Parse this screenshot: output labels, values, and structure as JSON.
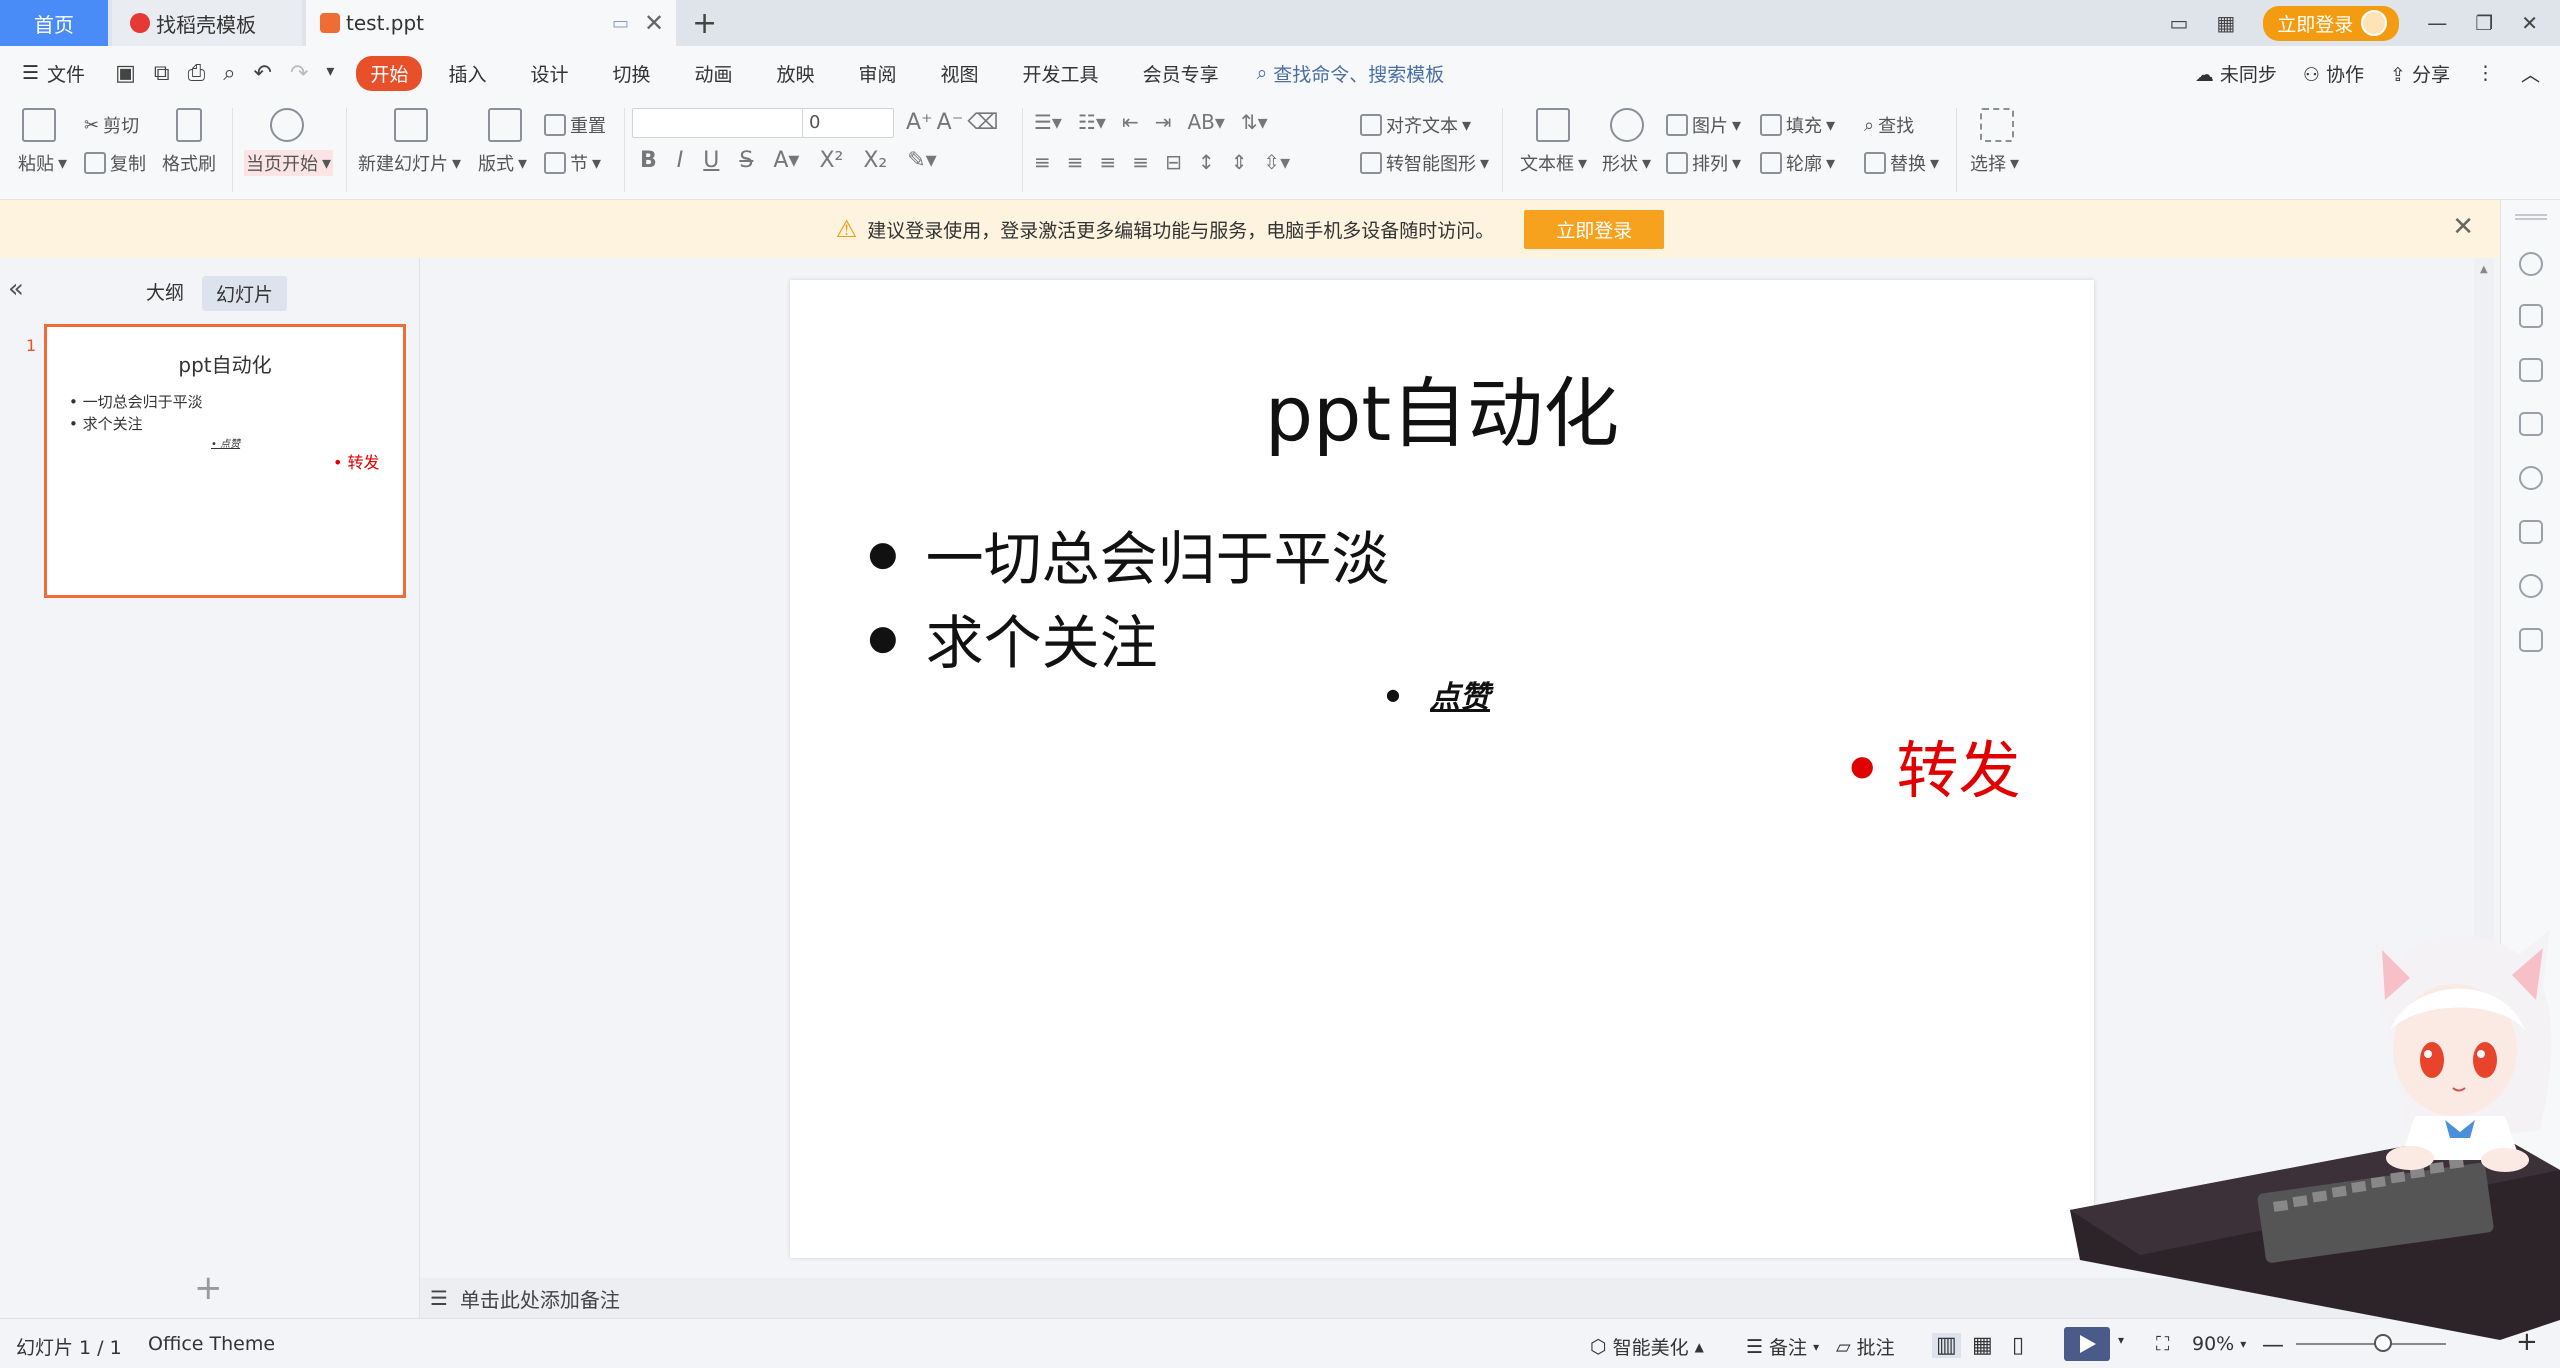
{
  "tabs": {
    "home": "首页",
    "template": "找稻壳模板",
    "document": "test.ppt"
  },
  "header": {
    "login_button": "立即登录"
  },
  "menu": {
    "file": "文件",
    "start": "开始",
    "items": [
      "插入",
      "设计",
      "切换",
      "动画",
      "放映",
      "审阅",
      "视图",
      "开发工具",
      "会员专享"
    ],
    "search": "查找命令、搜索模板",
    "sync": "未同步",
    "collab": "协作",
    "share": "分享"
  },
  "ribbon": {
    "paste": "粘贴",
    "cut": "剪切",
    "copy": "复制",
    "format_painter": "格式刷",
    "from_current": "当页开始",
    "new_slide": "新建幻灯片",
    "layout": "版式",
    "section": "节",
    "reset": "重置",
    "font_size": "0",
    "align_text": "对齐文本",
    "smart_shape": "转智能图形",
    "textbox": "文本框",
    "shape": "形状",
    "arrange": "排列",
    "picture": "图片",
    "fill": "填充",
    "outline": "轮廓",
    "find": "查找",
    "replace": "替换",
    "select": "选择"
  },
  "notice": {
    "text": "建议登录使用，登录激活更多编辑功能与服务，电脑手机多设备随时访问。",
    "button": "立即登录"
  },
  "left_panel": {
    "outline_tab": "大纲",
    "slides_tab": "幻灯片",
    "slide_number": "1"
  },
  "slide": {
    "title": "ppt自动化",
    "bullets": [
      "一切总会归于平淡",
      "求个关注"
    ],
    "sub_bullet": "点赞",
    "red_bullet": "转发",
    "red_color": "#e00000"
  },
  "notes": {
    "placeholder": "单击此处添加备注"
  },
  "status": {
    "slide_count": "幻灯片 1 / 1",
    "theme": "Office Theme",
    "beautify": "智能美化",
    "notes": "备注",
    "comments": "批注",
    "zoom": "90%"
  },
  "colors": {
    "accent": "#e8502a",
    "home_tab": "#4a8cf7",
    "login": "#f39c12"
  }
}
